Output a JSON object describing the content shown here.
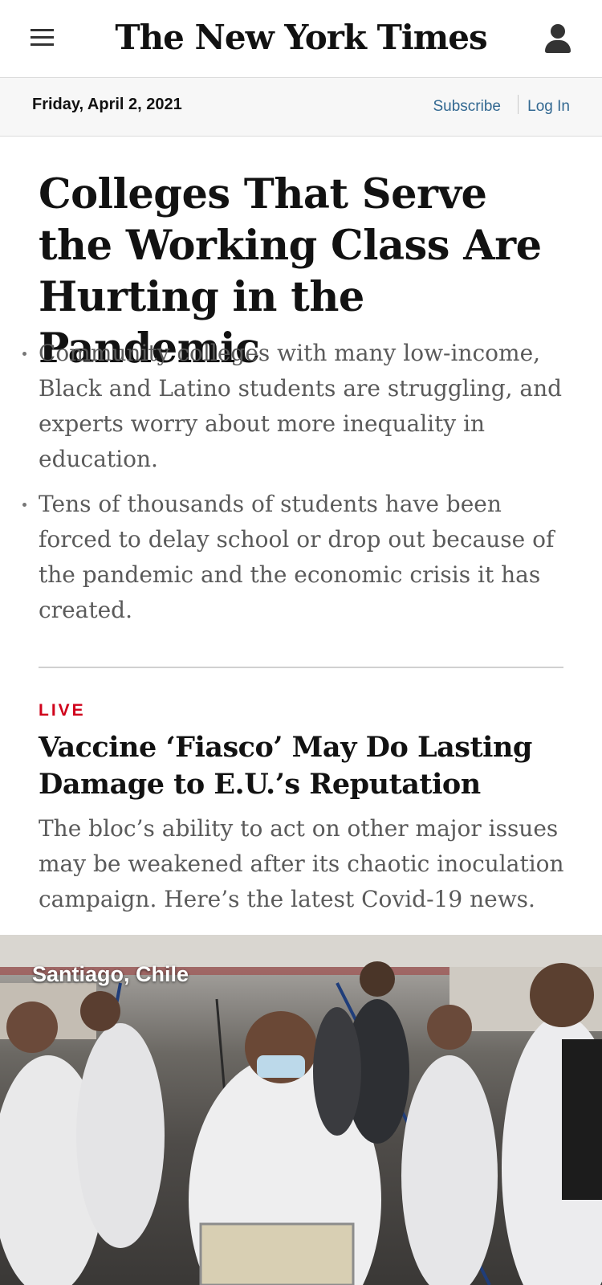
{
  "header": {
    "logo_text": "The New York Times",
    "menu_icon": "hamburger-menu-icon",
    "account_icon": "person-icon"
  },
  "datebar": {
    "date": "Friday, April 2, 2021",
    "subscribe": "Subscribe",
    "login": "Log In"
  },
  "lead_story": {
    "headline": "Colleges That Serve the Working Class Are Hurting in the Pandemic",
    "bullets": [
      "Community colleges with many low-income, Black and Latino students are struggling, and experts worry about more inequality in education.",
      "Tens of thousands of students have been forced to delay school or drop out because of the pandemic and the economic crisis it has created."
    ]
  },
  "second_story": {
    "label": "LIVE",
    "headline": "Vaccine ‘Fiasco’ May Do Lasting Damage to E.U.’s Reputation",
    "summary": "The bloc’s ability to act on other major issues may be weakened after its chaotic inoculation campaign. Here’s the latest Covid-19 news.",
    "photo_caption": "Santiago, Chile"
  },
  "colors": {
    "link": "#326891",
    "live": "#d0021b",
    "text": "#121212",
    "summary_text": "#5a5a5a"
  }
}
